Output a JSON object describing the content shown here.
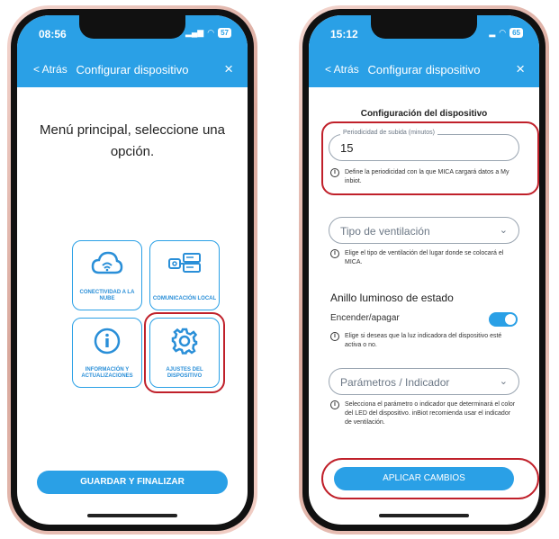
{
  "left_screen": {
    "status_time": "08:56",
    "battery": "57",
    "header": {
      "back_label": "< Atrás",
      "title": "Configurar dispositivo",
      "close_icon": "×"
    },
    "menu_title": "Menú principal, seleccione una opción.",
    "tiles": [
      {
        "label": "CONECTIVIDAD A LA NUBE",
        "icon": "cloud-wifi-icon"
      },
      {
        "label": "COMUNICACIÓN LOCAL",
        "icon": "local-device-icon"
      },
      {
        "label": "INFORMACIÓN Y ACTUALIZACIONES",
        "icon": "info-icon"
      },
      {
        "label": "AJUSTES DEL DISPOSITIVO",
        "icon": "gear-icon"
      }
    ],
    "save_button": "GUARDAR Y FINALIZAR",
    "accent_color": "#2aa0e6",
    "highlight_color": "#c0202a"
  },
  "right_screen": {
    "status_time": "15:12",
    "battery": "65",
    "header": {
      "back_label": "< Atrás",
      "title": "Configurar dispositivo",
      "close_icon": "×"
    },
    "section_title": "Configuración del dispositivo",
    "upload_period": {
      "legend": "Periodicidad de subida (minutos)",
      "value": "15",
      "help": "Define la periodicidad con la que MICA cargará datos a My inbiot."
    },
    "ventilation": {
      "placeholder": "Tipo de ventilación",
      "help": "Elige el tipo de ventilación del lugar donde se colocará el MICA."
    },
    "ring_title": "Anillo luminoso de estado",
    "toggle": {
      "label": "Encender/apagar",
      "enabled": true,
      "help": "Elige si deseas que la luz indicadora del dispositivo esté activa o no."
    },
    "parameter": {
      "placeholder": "Parámetros / Indicador",
      "help": "Selecciona el parámetro o indicador que determinará el color del LED del dispositivo. inBiot recomienda usar el indicador de ventilación."
    },
    "apply_button": "APLICAR CAMBIOS"
  }
}
